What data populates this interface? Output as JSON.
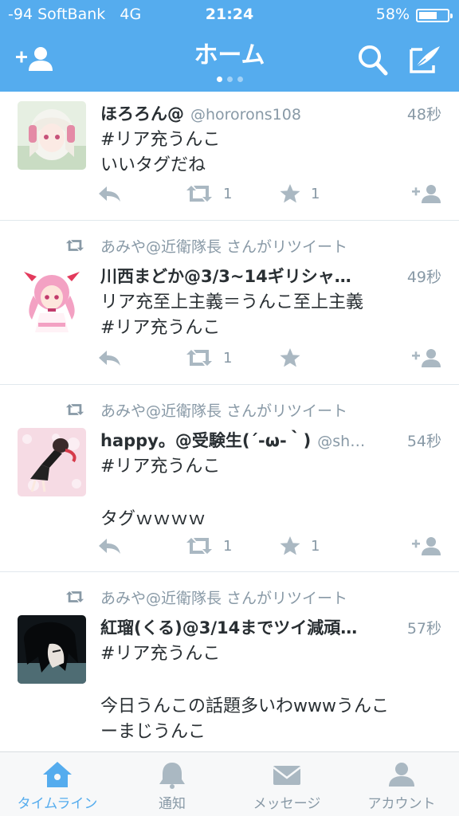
{
  "status_bar": {
    "carrier": "-94 SoftBank",
    "network": "4G",
    "time": "21:24",
    "battery": "58%",
    "battery_level": 0.58
  },
  "header": {
    "title": "ホーム",
    "page_count": 3,
    "active_page": 1,
    "icons": [
      "add-user-icon",
      "search-icon",
      "compose-icon"
    ],
    "color": "#55acee"
  },
  "tweets": [
    {
      "name": "ほろろん@",
      "handle": "@hororons108",
      "time": "48秒",
      "lines": [
        "#リア充うんこ",
        "いいタグだね"
      ],
      "retweets": "1",
      "favorites": "1"
    },
    {
      "retweeted_by": "あみや@近衛隊長 さんがリツイート",
      "name": "川西まどか@3/3~14ギリシャ…",
      "handle": "",
      "time": "49秒",
      "lines": [
        "リア充至上主義＝うんこ至上主義",
        "#リア充うんこ"
      ],
      "retweets": "1",
      "favorites": ""
    },
    {
      "retweeted_by": "あみや@近衛隊長 さんがリツイート",
      "name": "happy。@受験生(´-ω-｀)",
      "handle": "@sh…",
      "time": "54秒",
      "lines": [
        "#リア充うんこ",
        "",
        "タグｗｗｗｗ"
      ],
      "retweets": "1",
      "favorites": "1"
    },
    {
      "retweeted_by": "あみや@近衛隊長 さんがリツイート",
      "name": "紅瑠(くる)@3/14までツイ減頑…",
      "handle": "",
      "time": "57秒",
      "lines": [
        "#リア充うんこ",
        "",
        "今日うんこの話題多いわwwwうんこ",
        "ーまじうんこ"
      ],
      "retweets": "",
      "favorites": ""
    }
  ],
  "tabbar": {
    "items": [
      {
        "label": "タイムライン",
        "icon": "home-icon",
        "active": true
      },
      {
        "label": "通知",
        "icon": "bell-icon",
        "active": false
      },
      {
        "label": "メッセージ",
        "icon": "envelope-icon",
        "active": false
      },
      {
        "label": "アカウント",
        "icon": "person-icon",
        "active": false
      }
    ]
  }
}
